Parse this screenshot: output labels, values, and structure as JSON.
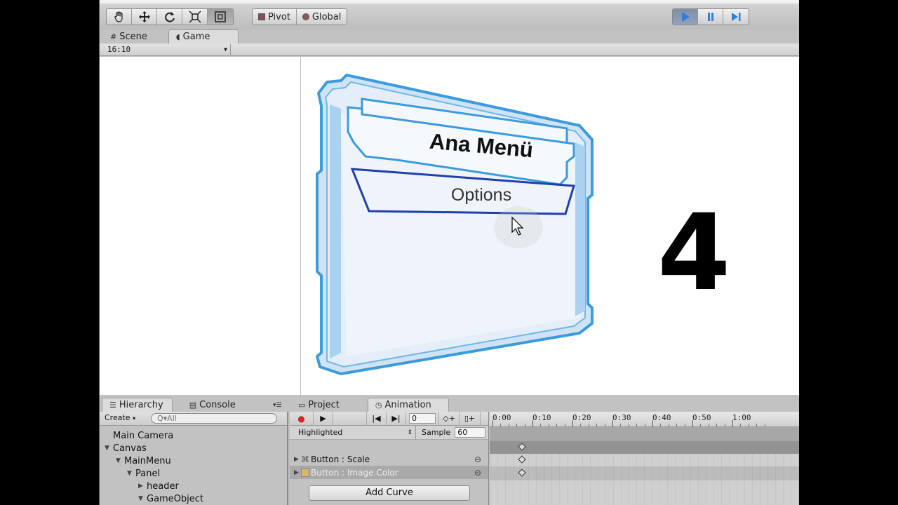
{
  "toolbar": {
    "transform_tools": [
      "hand-tool",
      "move-tool",
      "rotate-tool",
      "scale-tool",
      "rect-tool"
    ],
    "pivot_label": "Pivot",
    "global_label": "Global",
    "play_controls": [
      "play",
      "pause",
      "step"
    ]
  },
  "game_tabs": {
    "scene_label": "Scene",
    "game_label": "Game",
    "aspect_value": "16:10"
  },
  "game_view": {
    "menu_title": "Ana Menü",
    "menu_button": "Options",
    "overlay_number": "4"
  },
  "hierarchy": {
    "tab_label": "Hierarchy",
    "console_label": "Console",
    "create_label": "Create",
    "search_placeholder": "Q▾All",
    "items": [
      {
        "label": "Main Camera",
        "indent": 0,
        "arrow": ""
      },
      {
        "label": "Canvas",
        "indent": 0,
        "arrow": "▼"
      },
      {
        "label": "MainMenu",
        "indent": 1,
        "arrow": "▼"
      },
      {
        "label": "Panel",
        "indent": 2,
        "arrow": "▼"
      },
      {
        "label": "header",
        "indent": 3,
        "arrow": "▶"
      },
      {
        "label": "GameObject",
        "indent": 3,
        "arrow": "▼"
      }
    ]
  },
  "animation": {
    "project_label": "Project",
    "animation_label": "Animation",
    "frame_value": "0",
    "clip_value": "Highlighted",
    "sample_label": "Sample",
    "sample_value": "60",
    "properties": [
      {
        "label": "Button : Scale",
        "selected": false,
        "icon": "scale"
      },
      {
        "label": "Button : Image.Color",
        "selected": true,
        "icon": "image"
      }
    ],
    "add_curve_label": "Add Curve",
    "timeline_ticks": [
      "0:00",
      "0:10",
      "0:20",
      "0:30",
      "0:40",
      "0:50",
      "1:00"
    ]
  },
  "colors": {
    "frame_blue": "#3b9bdc",
    "button_outline": "#1f3fb0",
    "play_active": "#2f7fe0"
  }
}
